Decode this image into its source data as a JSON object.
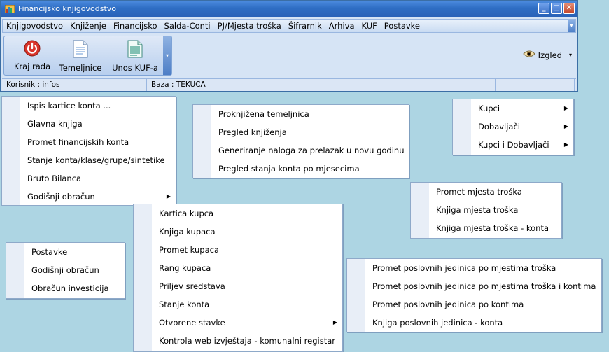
{
  "window": {
    "title": "Financijsko knjigovodstvo",
    "buttons": [
      "minimize",
      "maximize",
      "close"
    ]
  },
  "menubar": {
    "items": [
      "Knjigovodstvo",
      "Knjiženje",
      "Financijsko",
      "Salda-Conti",
      "PJ/Mjesta troška",
      "Šifrarnik",
      "Arhiva",
      "KUF",
      "Postavke"
    ]
  },
  "toolbar": {
    "buttons": [
      {
        "label": "Kraj rada",
        "icon": "power-icon"
      },
      {
        "label": "Temeljnice",
        "icon": "document-icon"
      },
      {
        "label": "Unos KUF-a",
        "icon": "invoice-icon"
      }
    ],
    "izgled_label": "Izgled"
  },
  "status": {
    "korisnik": "Korisnik : infos",
    "baza": "Baza : TEKUCA"
  },
  "menus": {
    "knjigovodstvo": [
      "Ispis kartice konta ...",
      "Glavna knjiga",
      "Promet financijskih konta",
      "Stanje konta/klase/grupe/sintetike",
      "Bruto Bilanca",
      "Godišnji obračun"
    ],
    "knjizenje": [
      "Proknjižena temeljnica",
      "Pregled knjiženja",
      "Generiranje naloga za prelazak u novu godinu",
      "Pregled stanja konta po mjesecima"
    ],
    "salda": [
      "Kupci",
      "Dobavljači",
      "Kupci i Dobavljači"
    ],
    "mjesta": [
      "Promet mjesta troška",
      "Knjiga mjesta troška",
      "Knjiga mjesta troška - konta"
    ],
    "kupci": [
      "Kartica kupca",
      "Knjiga kupaca",
      "Promet kupaca",
      "Rang kupaca",
      "Priljev sredstava",
      "Stanje konta",
      "Otvorene stavke",
      "Kontrola web izvještaja - komunalni registar"
    ],
    "postavke": [
      "Postavke",
      "Godišnji obračun",
      "Obračun investicija"
    ],
    "pj": [
      "Promet poslovnih jedinica po mjestima troška",
      "Promet poslovnih jedinica po mjestima troška i kontima",
      "Promet poslovnih jedinica po kontima",
      "Knjiga poslovnih jedinica - konta"
    ]
  },
  "colors": {
    "desktop": "#add5e3",
    "titlebar": "#2f6ec4",
    "menu_border": "#8ea9c9"
  }
}
